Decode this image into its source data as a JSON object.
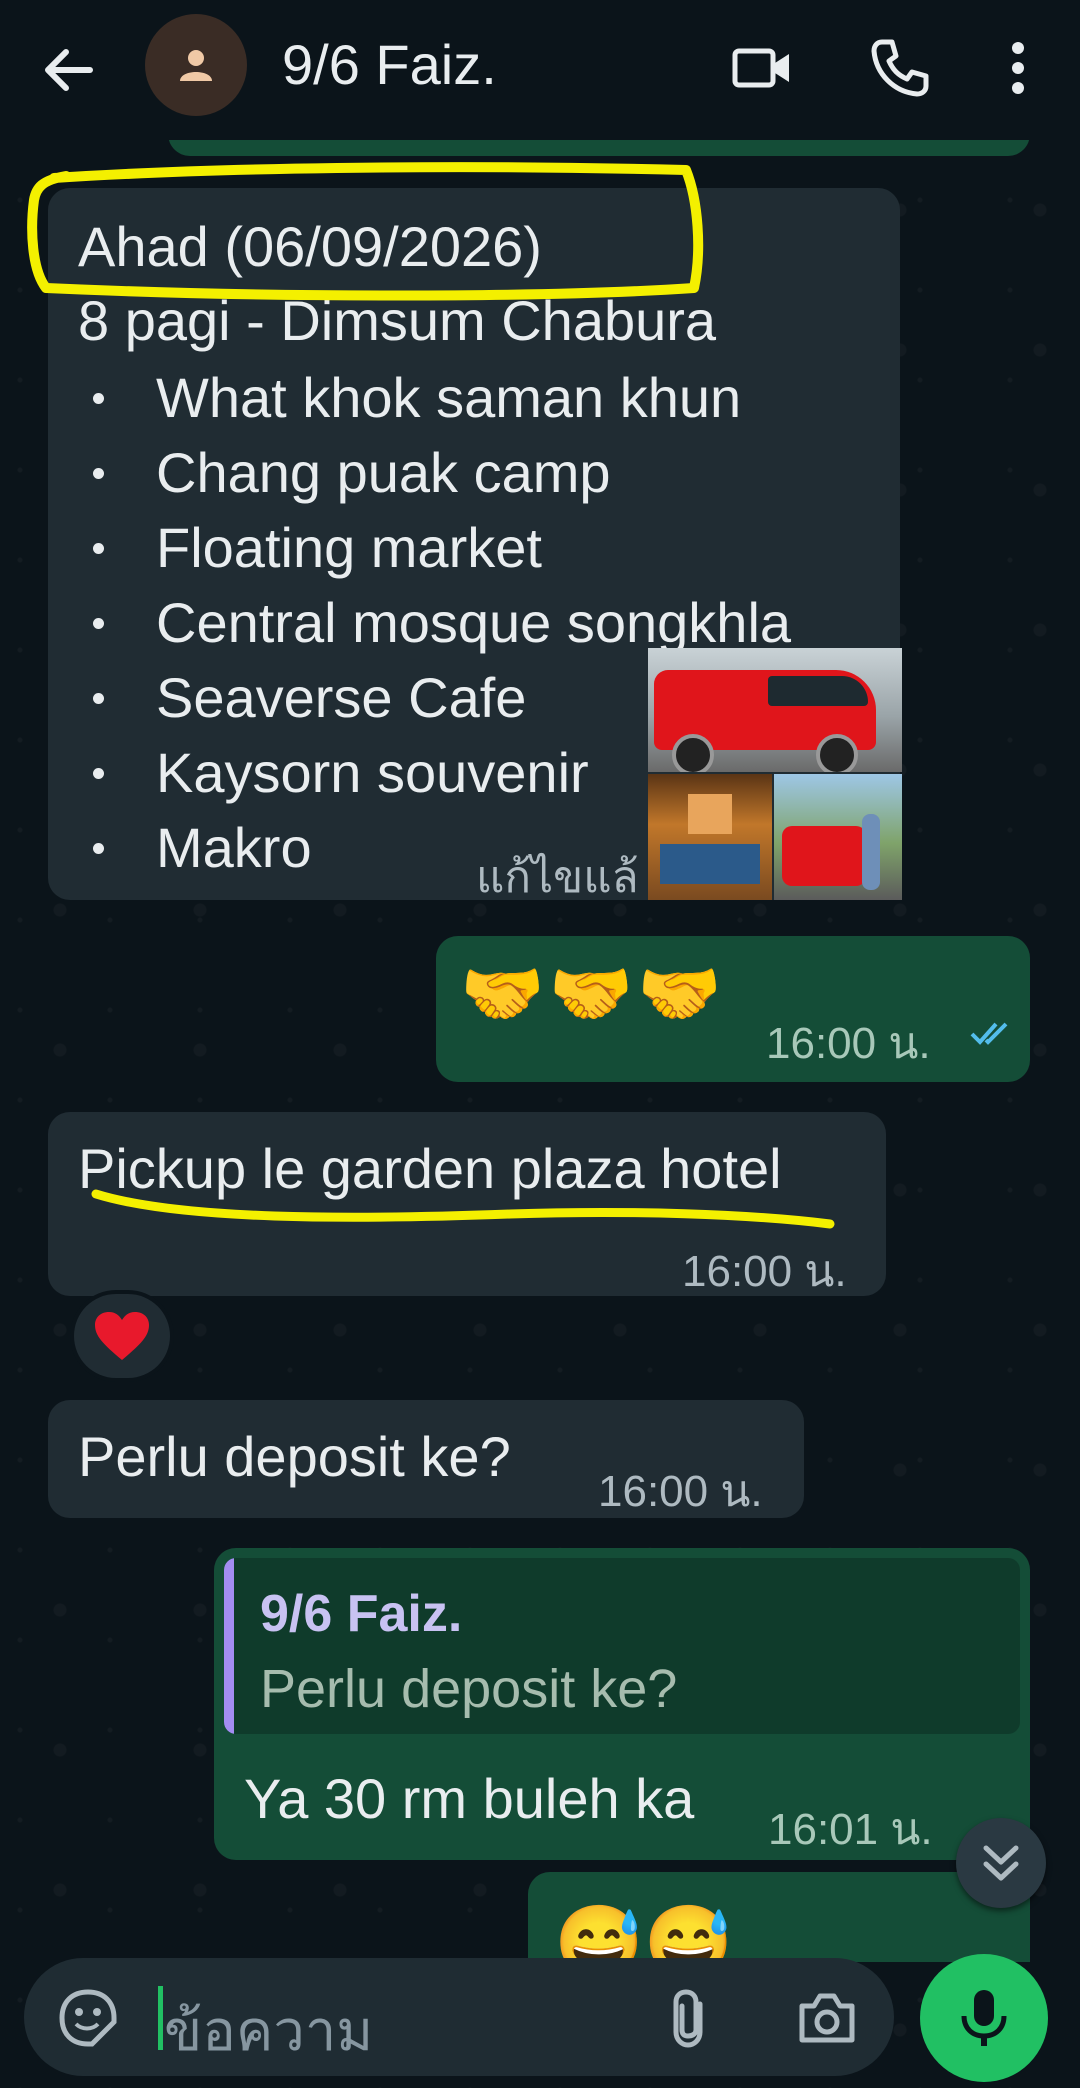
{
  "header": {
    "title": "9/6 Faiz.",
    "icons": [
      "back-arrow-icon",
      "avatar-person-icon",
      "video-call-icon",
      "phone-icon",
      "more-vert-icon"
    ]
  },
  "messages": {
    "itinerary": {
      "heading": "Ahad (06/09/2026)",
      "subheading": "8 pagi - Dimsum Chabura",
      "items": [
        "What khok saman khun",
        "Chang puak camp",
        "Floating market",
        "Central mosque songkhla",
        "Seaverse Cafe",
        "Kaysorn souvenir",
        "Makro"
      ],
      "edited_label": "แก้ไขแล้"
    },
    "emoji_msg": {
      "text": "🤝🤝🤝",
      "time": "16:00 น."
    },
    "pickup": {
      "text": "Pickup le garden plaza hotel",
      "time": "16:00 น."
    },
    "reaction": "❤️",
    "deposit": {
      "text": "Perlu deposit ke?",
      "time": "16:00 น."
    },
    "reply": {
      "quoted_author": "9/6 Faiz.",
      "quoted_text": "Perlu deposit ke?",
      "text": "Ya 30 rm buleh ka",
      "time": "16:01 น."
    },
    "partial_emoji": "😅😅"
  },
  "input": {
    "placeholder": "ข้อความ"
  },
  "colors": {
    "incoming": "#202c33",
    "outgoing": "#144d37",
    "highlight": "#f4f000",
    "accent_green": "#21c063",
    "read_ticks": "#53bdeb"
  }
}
